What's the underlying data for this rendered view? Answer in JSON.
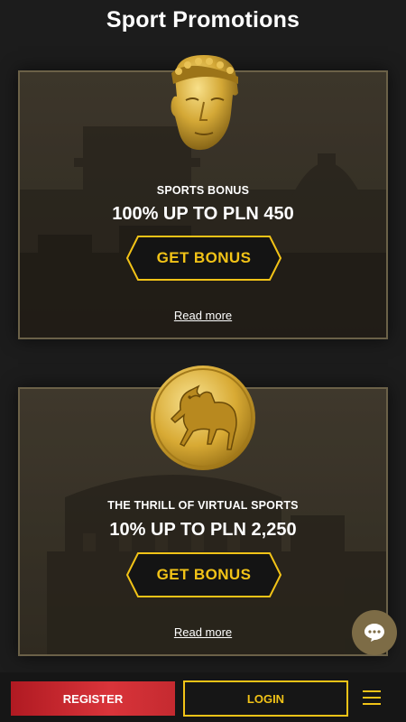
{
  "page": {
    "title": "Sport Promotions"
  },
  "promotions": [
    {
      "emblem": "golden-mask-icon",
      "label": "SPORTS BONUS",
      "offer": "100% UP TO PLN 450",
      "button_label": "GET BONUS",
      "read_more": "Read more"
    },
    {
      "emblem": "golden-horse-coin-icon",
      "label": "THE THRILL OF VIRTUAL SPORTS",
      "offer": "10% UP TO PLN 2,250",
      "button_label": "GET BONUS",
      "read_more": "Read more"
    }
  ],
  "bottom_bar": {
    "register_label": "REGISTER",
    "login_label": "LOGIN",
    "menu_icon": "hamburger-menu-icon"
  },
  "chat": {
    "icon": "chat-bubble-icon"
  },
  "colors": {
    "accent": "#f2c317",
    "register": "#d1282f",
    "card_border": "#6b6148",
    "chat": "#7d6c46"
  }
}
